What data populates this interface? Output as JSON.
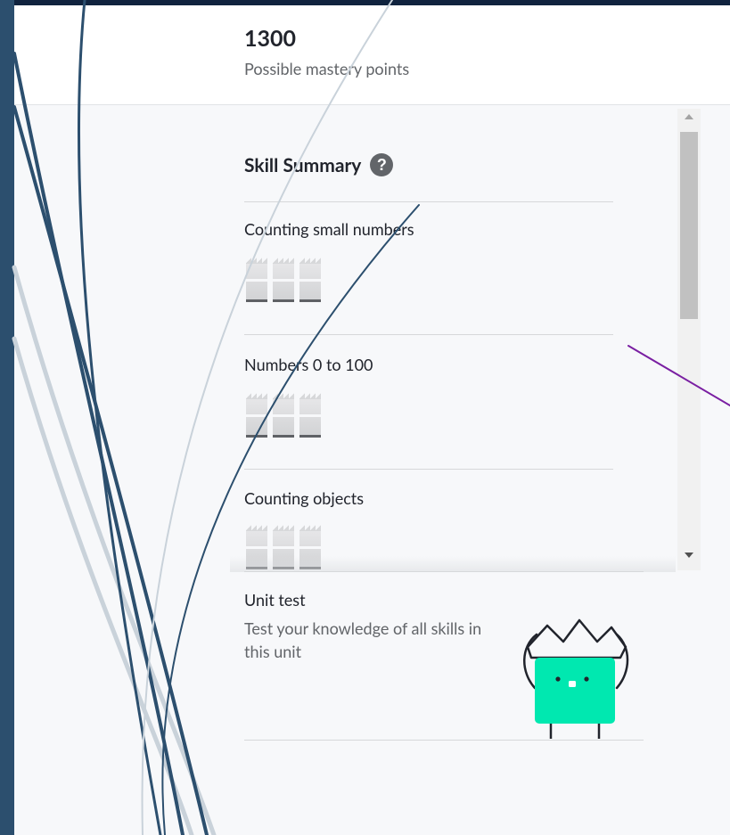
{
  "header": {
    "mastery_points": "1300",
    "mastery_label": "Possible mastery points"
  },
  "summary": {
    "title": "Skill Summary",
    "help_icon": "question-circle-icon",
    "skills": [
      {
        "name": "Counting small numbers",
        "mastery_levels_filled": 0,
        "mastery_levels_total": 3
      },
      {
        "name": "Numbers 0 to 100",
        "mastery_levels_filled": 0,
        "mastery_levels_total": 3
      },
      {
        "name": "Counting objects",
        "mastery_levels_filled": 0,
        "mastery_levels_total": 3
      }
    ]
  },
  "unit_test": {
    "title": "Unit test",
    "description": "Test your knowledge of all skills in this unit",
    "illustration": "crowned-cube-character-icon"
  },
  "colors": {
    "character_green": "#00e8b0",
    "annotation_arrow": "#7a1fa2"
  }
}
